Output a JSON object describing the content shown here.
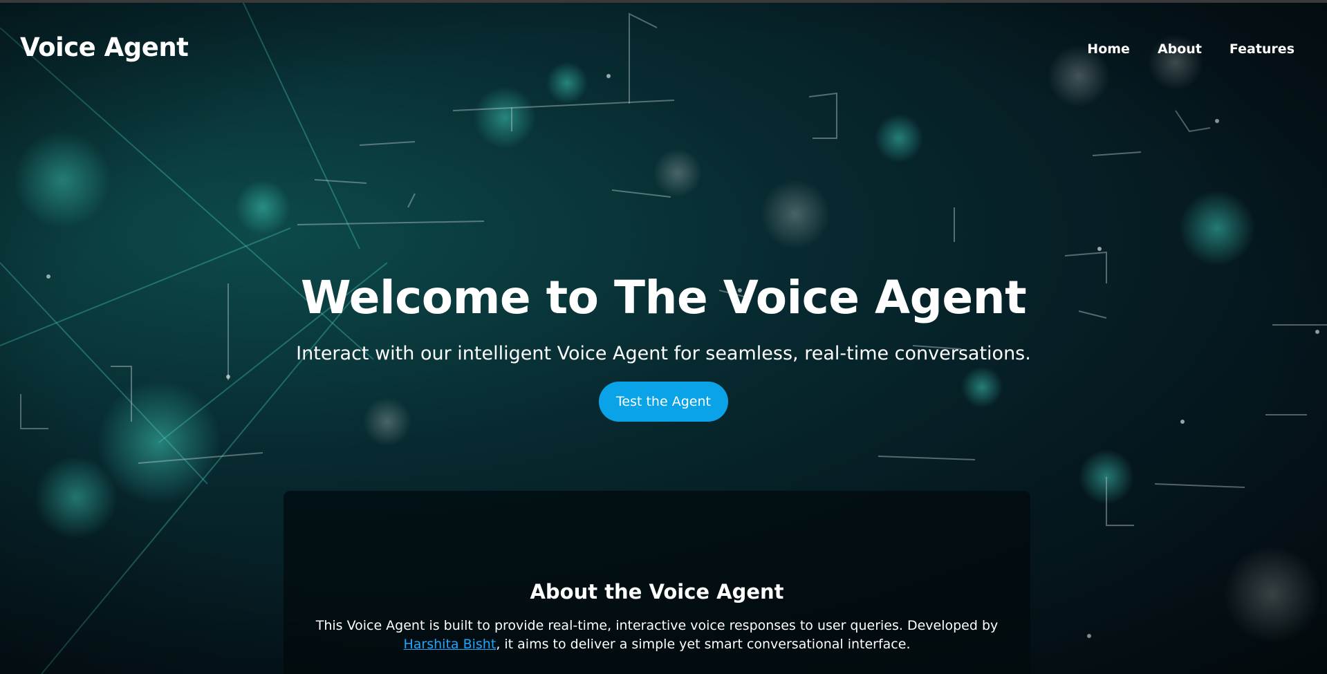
{
  "nav": {
    "brand": "Voice Agent",
    "links": [
      "Home",
      "About",
      "Features"
    ]
  },
  "hero": {
    "title": "Welcome to The Voice Agent",
    "subtitle": "Interact with our intelligent Voice Agent for seamless, real-time conversations.",
    "cta_label": "Test the Agent"
  },
  "about": {
    "title": "About the Voice Agent",
    "text_before": "This Voice Agent is built to provide real-time, interactive voice responses to user queries. Developed by ",
    "author_link": "Harshita Bisht",
    "text_after": ", it aims to deliver a simple yet smart conversational interface."
  },
  "colors": {
    "accent": "#0aa3e8",
    "link": "#1ea7ff",
    "background": "#05161d"
  }
}
